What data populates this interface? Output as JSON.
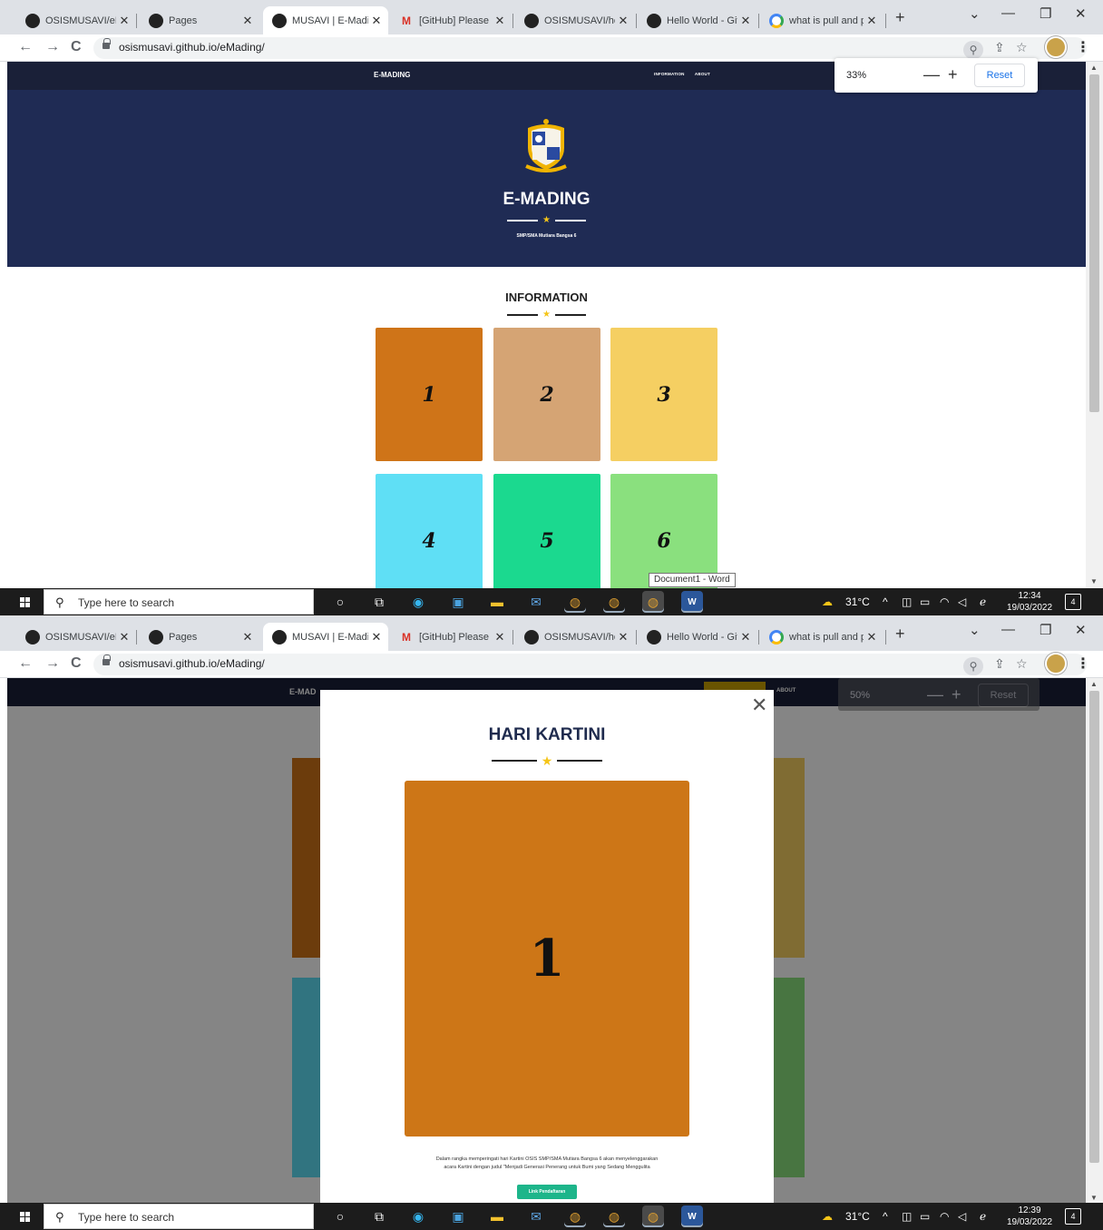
{
  "browser": {
    "tabs": [
      {
        "label": "OSISMUSAVI/eM",
        "icon": "github-icon"
      },
      {
        "label": "Pages",
        "icon": "github-icon"
      },
      {
        "label": "MUSAVI | E-Madi",
        "icon": "website-icon"
      },
      {
        "label": "[GitHub] Please r",
        "icon": "gmail-icon"
      },
      {
        "label": "OSISMUSAVI/hel",
        "icon": "github-icon"
      },
      {
        "label": "Hello World - Git",
        "icon": "github-icon"
      },
      {
        "label": "what is pull and p",
        "icon": "google-icon"
      }
    ],
    "url": "osismusavi.github.io/eMading/"
  },
  "shot1": {
    "zoom": {
      "percent": "33%",
      "minus": "—",
      "plus": "+",
      "reset": "Reset"
    },
    "site": {
      "brand": "E-MADING",
      "nav": [
        "INFORMATION",
        "ABOUT"
      ],
      "hero_title": "E-MADING",
      "hero_subtitle": "SMP/SMA Mutiara Bangsa 6",
      "section_title": "INFORMATION",
      "cards": [
        {
          "label": "1",
          "color": "#cf7418"
        },
        {
          "label": "2",
          "color": "#d5a474"
        },
        {
          "label": "3",
          "color": "#f5cf62"
        },
        {
          "label": "4",
          "color": "#5fdff5"
        },
        {
          "label": "5",
          "color": "#1bd98f"
        },
        {
          "label": "6",
          "color": "#8ae07e"
        }
      ]
    },
    "tooltip": "Document1 - Word",
    "taskbar": {
      "search": "Type here to search",
      "temp": "31°C",
      "time": "12:34",
      "date": "19/03/2022",
      "notifications": "4"
    }
  },
  "shot2": {
    "zoom": {
      "percent": "50%",
      "reset": "Reset"
    },
    "site": {
      "brand": "E-MAD",
      "nav_about": "ABOUT"
    },
    "modal": {
      "title": "HARI KARTINI",
      "poster_label": "1",
      "poster_color": "#cd7617",
      "description_line1": "Dalam rangka memperingati hari Kartini OSIS SMP/SMA Mutiara Bangsa 6 akan menyelenggarakan",
      "description_line2": "acara Kartini dengan judul \"Menjadi Generasi Penerang untuk Bumi yang Sedang Menggulita",
      "button": "Link Pendaftaran"
    },
    "taskbar": {
      "search": "Type here to search",
      "temp": "31°C",
      "time": "12:39",
      "date": "19/03/2022",
      "notifications": "4"
    }
  },
  "colors": {
    "navy": "#1f2b54",
    "nav_dark": "#1a2038",
    "star": "#f5c518",
    "accent_green": "#1db58a"
  }
}
